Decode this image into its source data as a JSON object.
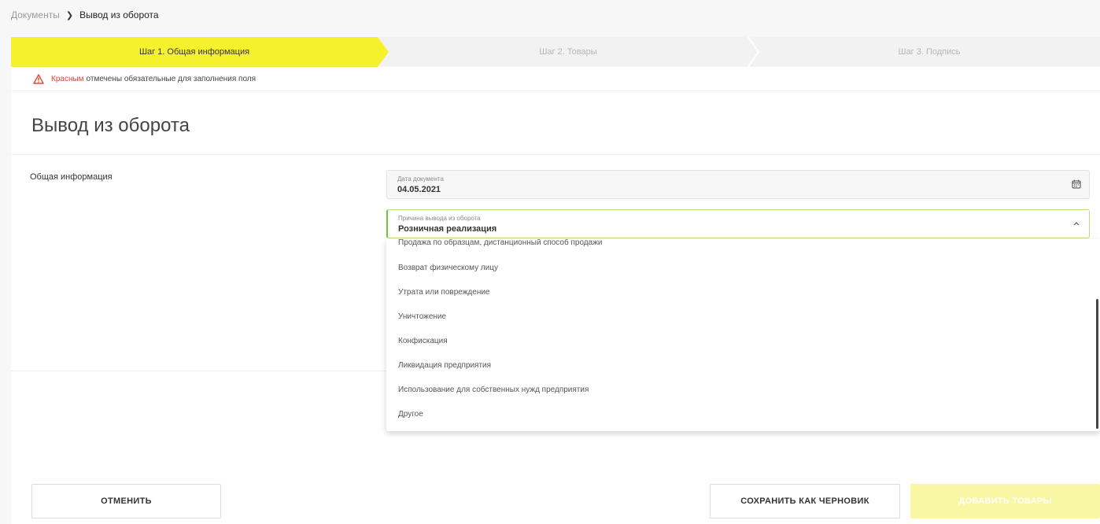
{
  "breadcrumb": {
    "parent": "Документы",
    "current": "Вывод из оборота"
  },
  "steps": [
    {
      "label": "Шаг 1. Общая информация",
      "active": true
    },
    {
      "label": "Шаг 2. Товары",
      "active": false
    },
    {
      "label": "Шаг 3. Подпись",
      "active": false
    }
  ],
  "notice": {
    "highlight": "Красным",
    "text": "отмечены обязательные для заполнения поля"
  },
  "page": {
    "title": "Вывод из оборота",
    "section_label": "Общая информация"
  },
  "date_field": {
    "label": "Дата документа",
    "value": "04.05.2021",
    "icon": "calendar-icon"
  },
  "reason_field": {
    "label": "Причина вывода из оборота",
    "value": "Розничная реализация",
    "icon": "chevron-up-icon"
  },
  "reason_options": [
    "Продажа по образцам, дистанционный способ продажи",
    "Возврат физическому лицу",
    "Утрата или повреждение",
    "Уничтожение",
    "Конфискация",
    "Ликвидация предприятия",
    "Использование для собственных нужд предприятия",
    "Другое"
  ],
  "buttons": {
    "cancel": "ОТМЕНИТЬ",
    "draft": "СОХРАНИТЬ КАК ЧЕРНОВИК",
    "add": "ДОБАВИТЬ ТОВАРЫ"
  },
  "colors": {
    "accent_yellow": "#f5f22d",
    "required_red": "#e0453a",
    "valid_green": "#6fc13d",
    "disabled_yellow": "#faf7a4"
  }
}
